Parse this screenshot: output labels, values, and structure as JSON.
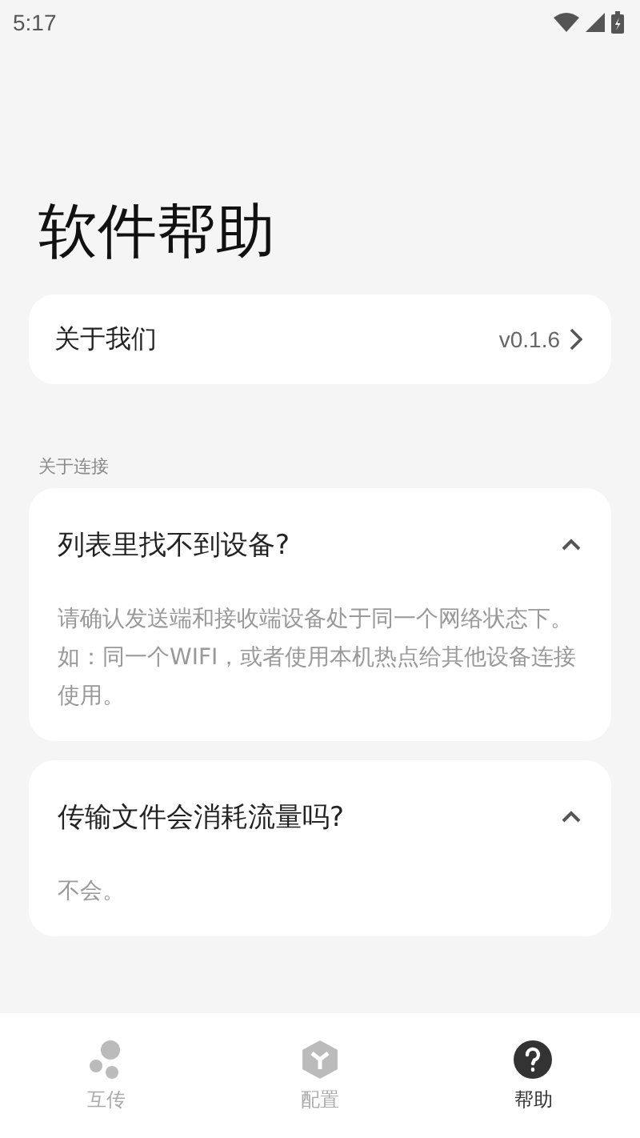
{
  "status_bar": {
    "time": "5:17"
  },
  "title": "软件帮助",
  "about": {
    "label": "关于我们",
    "version": "v0.1.6"
  },
  "section": {
    "title": "关于连接"
  },
  "faqs": [
    {
      "question": "列表里找不到设备?",
      "answer": "请确认发送端和接收端设备处于同一个网络状态下。如：同一个WIFI，或者使用本机热点给其他设备连接使用。",
      "expanded": true
    },
    {
      "question": "传输文件会消耗流量吗?",
      "answer": "不会。",
      "expanded": true
    }
  ],
  "nav": [
    {
      "label": "互传",
      "kind": "transfer",
      "selected": false
    },
    {
      "label": "配置",
      "kind": "config",
      "selected": false
    },
    {
      "label": "帮助",
      "kind": "help",
      "selected": true
    }
  ]
}
